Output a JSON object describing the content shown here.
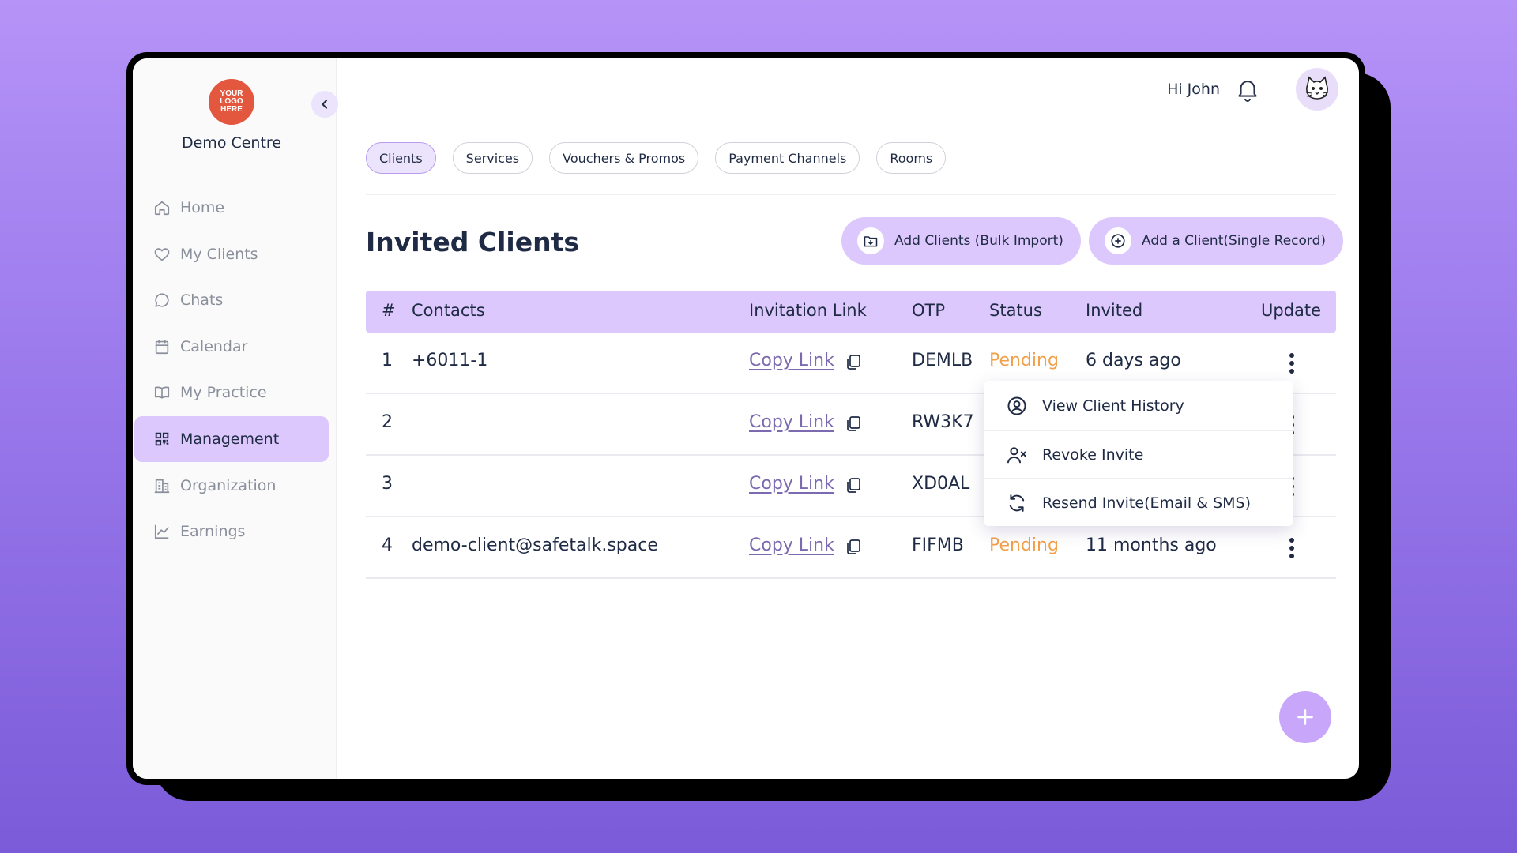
{
  "sidebar": {
    "logo_lines": [
      "YOUR",
      "LOGO",
      "HERE"
    ],
    "centre_name": "Demo Centre",
    "items": [
      {
        "label": "Home",
        "icon": "home-icon"
      },
      {
        "label": "My Clients",
        "icon": "heart-icon"
      },
      {
        "label": "Chats",
        "icon": "chat-bubble-icon"
      },
      {
        "label": "Calendar",
        "icon": "calendar-icon"
      },
      {
        "label": "My Practice",
        "icon": "book-icon"
      },
      {
        "label": "Management",
        "icon": "grid-icon",
        "active": true
      },
      {
        "label": "Organization",
        "icon": "building-icon"
      },
      {
        "label": "Earnings",
        "icon": "line-chart-icon"
      }
    ]
  },
  "header": {
    "greeting": "Hi John",
    "icons": [
      "bell-icon",
      "cat-avatar"
    ]
  },
  "tabs": [
    "Clients",
    "Services",
    "Vouchers & Promos",
    "Payment Channels",
    "Rooms"
  ],
  "active_tab": "Clients",
  "page_title": "Invited Clients",
  "actions": {
    "bulk_import": "Add Clients (Bulk Import)",
    "single_record": "Add a Client(Single Record)"
  },
  "table": {
    "headers": [
      "#",
      "Contacts",
      "Invitation Link",
      "OTP",
      "Status",
      "Invited",
      "Update"
    ],
    "rows": [
      {
        "num": "1",
        "contact": "+6011-1",
        "link": "Copy Link",
        "otp": "DEMLB",
        "status": "Pending",
        "invited": "6 days ago"
      },
      {
        "num": "2",
        "contact": "",
        "link": "Copy Link",
        "otp": "RW3K7",
        "status": "",
        "invited": ""
      },
      {
        "num": "3",
        "contact": "",
        "link": "Copy Link",
        "otp": "XD0AL",
        "status": "",
        "invited": ""
      },
      {
        "num": "4",
        "contact": "demo-client@safetalk.space",
        "link": "Copy Link",
        "otp": "FIFMB",
        "status": "Pending",
        "invited": "11 months ago"
      }
    ]
  },
  "row_menu": {
    "items": [
      {
        "label": "View Client History",
        "icon": "user-circle-icon"
      },
      {
        "label": "Revoke Invite",
        "icon": "user-remove-icon"
      },
      {
        "label": "Resend Invite(Email & SMS)",
        "icon": "refresh-icon"
      }
    ]
  },
  "colors": {
    "accent": "#dcc8fd",
    "pending": "#f2a04a",
    "link": "#7c6ab0",
    "logo": "#e2573d"
  }
}
